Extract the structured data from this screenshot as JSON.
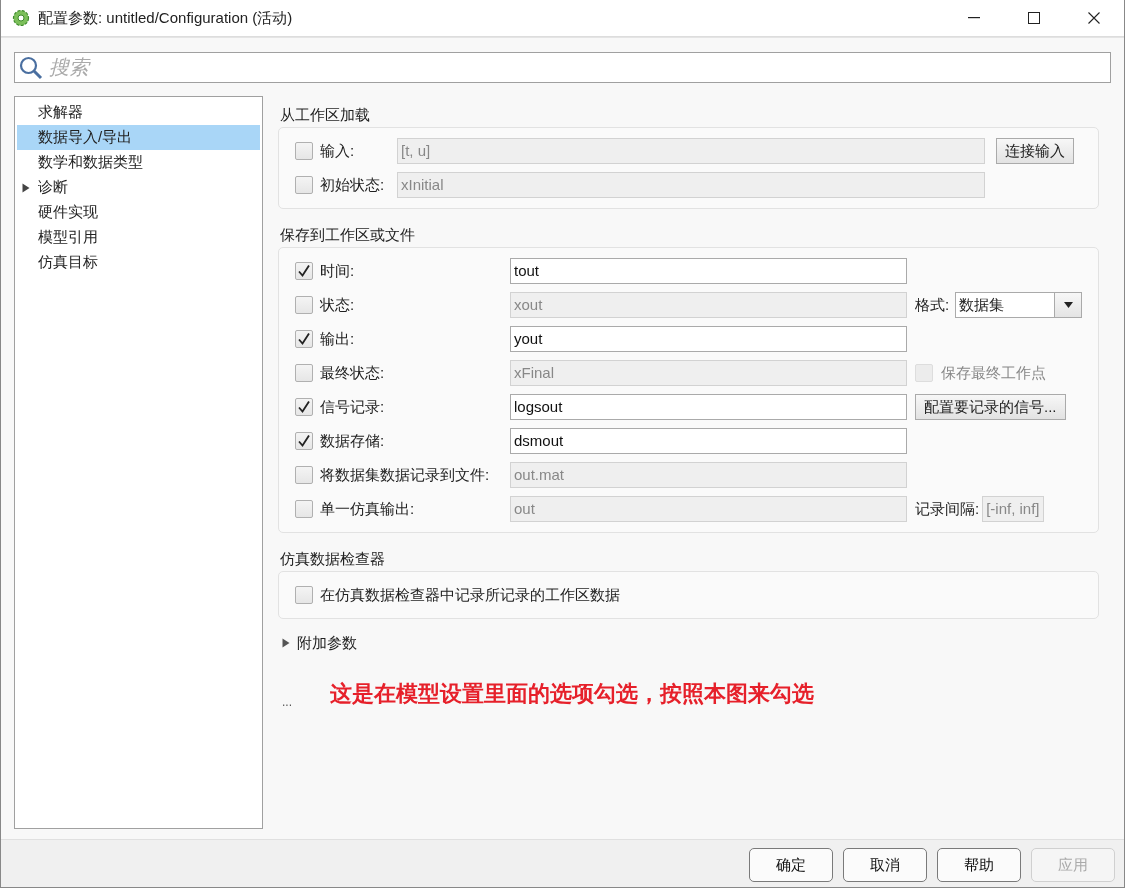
{
  "window": {
    "title": "配置参数: untitled/Configuration (活动)"
  },
  "search": {
    "placeholder": "搜索"
  },
  "tree": {
    "items": [
      {
        "label": "求解器",
        "kind": "leaf",
        "selected": false
      },
      {
        "label": "数据导入/导出",
        "kind": "leaf",
        "selected": true
      },
      {
        "label": "数学和数据类型",
        "kind": "leaf",
        "selected": false
      },
      {
        "label": "诊断",
        "kind": "folder",
        "expanded": false,
        "selected": false
      },
      {
        "label": "硬件实现",
        "kind": "leaf",
        "selected": false
      },
      {
        "label": "模型引用",
        "kind": "leaf",
        "selected": false
      },
      {
        "label": "仿真目标",
        "kind": "leaf",
        "selected": false
      }
    ]
  },
  "sections": [
    {
      "title": "从工作区加载",
      "rows": [
        {
          "label": "输入:",
          "checked": false,
          "value": "[t, u]",
          "extra": {
            "kind": "button",
            "label": "连接输入"
          }
        },
        {
          "label": "初始状态:",
          "checked": false,
          "value": "xInitial"
        }
      ]
    },
    {
      "title": "保存到工作区或文件",
      "rows": [
        {
          "label": "时间:",
          "checked": true,
          "value": "tout"
        },
        {
          "label": "状态:",
          "checked": false,
          "value": "xout",
          "extra": {
            "kind": "dropdown",
            "label": "格式:",
            "value": "数据集"
          }
        },
        {
          "label": "输出:",
          "checked": true,
          "value": "yout"
        },
        {
          "label": "最终状态:",
          "checked": false,
          "value": "xFinal",
          "extra": {
            "kind": "checkbox",
            "label": "保存最终工作点",
            "checked": false,
            "disabled": true
          }
        },
        {
          "label": "信号记录:",
          "checked": true,
          "value": "logsout",
          "extra": {
            "kind": "button",
            "label": "配置要记录的信号..."
          }
        },
        {
          "label": "数据存储:",
          "checked": true,
          "value": "dsmout"
        },
        {
          "label": "将数据集数据记录到文件:",
          "checked": false,
          "value": "out.mat"
        },
        {
          "label": "单一仿真输出:",
          "checked": false,
          "value": "out",
          "extra": {
            "kind": "field",
            "label": "记录间隔:",
            "value": "[-inf, inf]",
            "disabled": true
          }
        }
      ]
    },
    {
      "title": "仿真数据检查器",
      "rows": [
        {
          "label": "在仿真数据检查器中记录所记录的工作区数据",
          "checked": false
        }
      ]
    }
  ],
  "additional": {
    "label": "附加参数",
    "expanded": false
  },
  "ellipsis": "...",
  "annotation": "这是在模型设置里面的选项勾选，按照本图来勾选",
  "buttons": [
    {
      "label": "确定",
      "disabled": false
    },
    {
      "label": "取消",
      "disabled": false
    },
    {
      "label": "帮助",
      "disabled": false
    },
    {
      "label": "应用",
      "disabled": true
    }
  ]
}
